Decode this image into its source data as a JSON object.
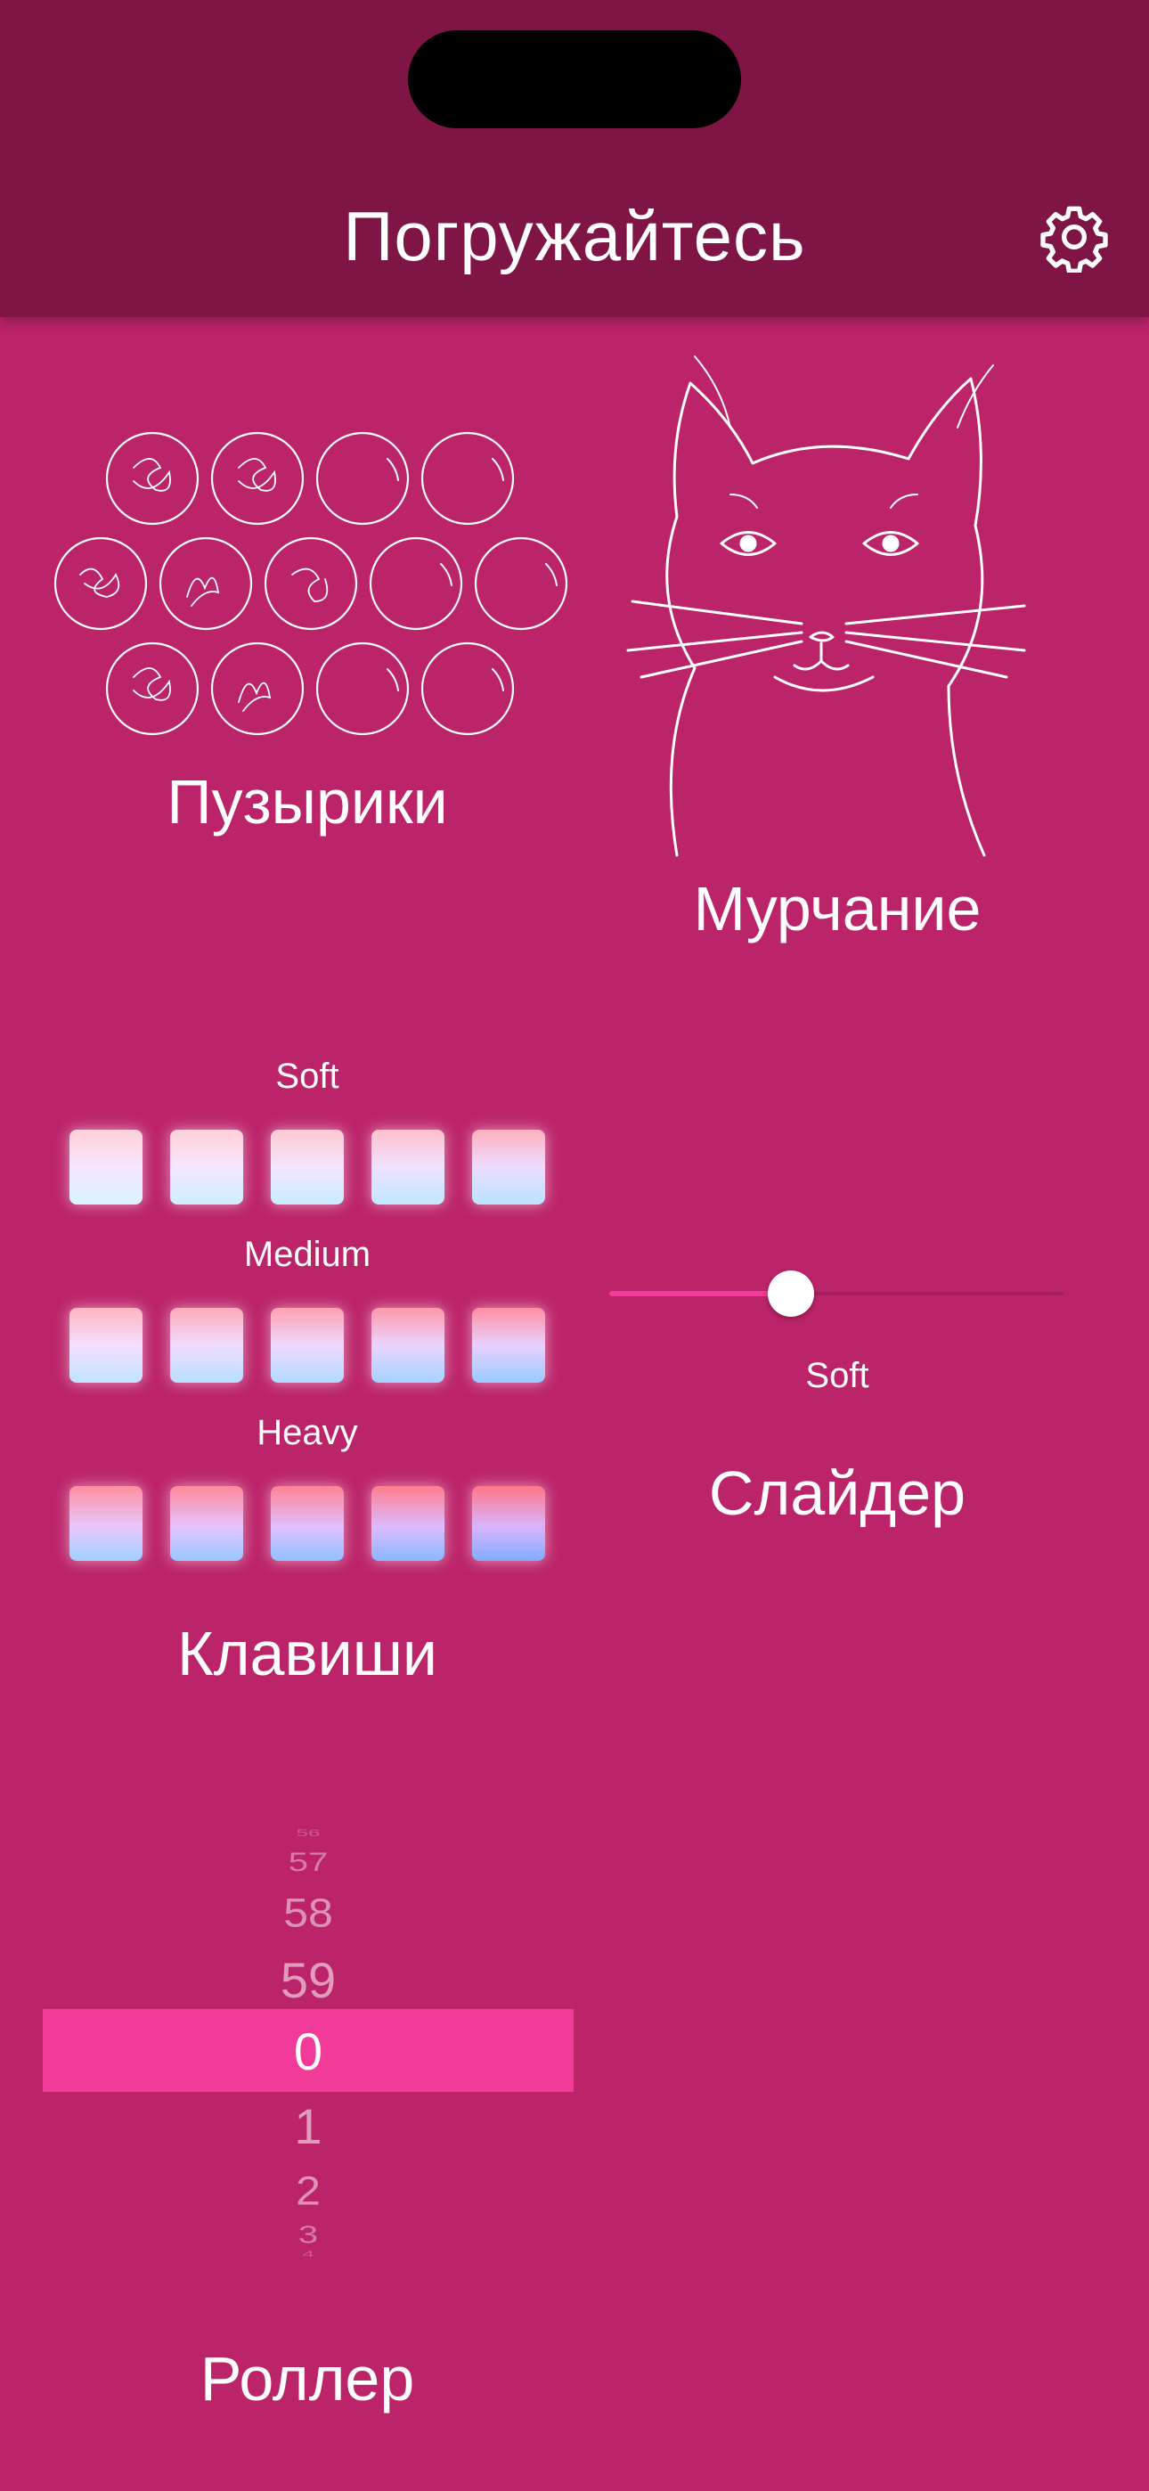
{
  "header": {
    "title": "Погружайтесь",
    "settings_icon": "gear-icon"
  },
  "tiles": {
    "bubbles": {
      "label": "Пузырики",
      "icon": "bubbles-icon"
    },
    "purring": {
      "label": "Мурчание",
      "icon": "cat-icon"
    },
    "keys": {
      "label": "Клавиши",
      "rows": [
        {
          "name": "Soft",
          "count": 5
        },
        {
          "name": "Medium",
          "count": 5
        },
        {
          "name": "Heavy",
          "count": 5
        }
      ]
    },
    "slider": {
      "label": "Слайдер",
      "value_label": "Soft",
      "value": 0.4
    },
    "roller": {
      "label": "Роллер",
      "values": [
        "56",
        "57",
        "58",
        "59",
        "0",
        "1",
        "2",
        "3",
        "4"
      ],
      "selected": "0"
    }
  },
  "colors": {
    "background": "#bc246a",
    "header": "#7f1544",
    "accent": "#f23a98"
  }
}
